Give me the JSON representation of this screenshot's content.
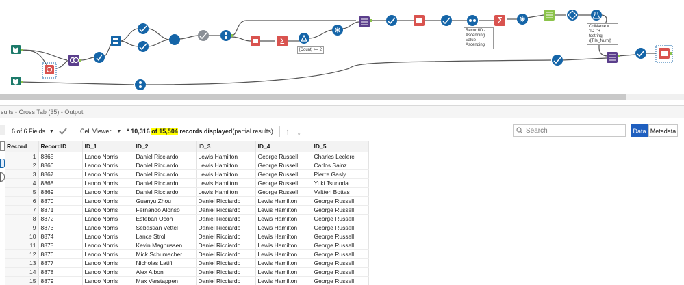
{
  "workflow": {
    "tool_labels": [
      "[Count] >= 2",
      "RecordID -\nAscending\nValue - Ascending",
      "ColName = \"ID_\"+\ntostring\n([Tile_Num])"
    ]
  },
  "results": {
    "title": "sults - Cross Tab (35) - Output"
  },
  "toolbar": {
    "fields_label": "6 of 6 Fields",
    "cell_viewer_label": "Cell Viewer",
    "records_prefix": "* 10,316 ",
    "records_of": "of ",
    "records_total": "15,504",
    "records_suffix": " records displayed",
    "records_note": "(partial results)",
    "search_placeholder": "Search",
    "data_tab": "Data",
    "metadata_tab": "Metadata"
  },
  "grid": {
    "columns": [
      "Record",
      "RecordID",
      "ID_1",
      "ID_2",
      "ID_3",
      "ID_4",
      "ID_5"
    ],
    "rows": [
      [
        "1",
        "8865",
        "Lando Norris",
        "Daniel Ricciardo",
        "Lewis Hamilton",
        "George Russell",
        "Charles Leclerc"
      ],
      [
        "2",
        "8866",
        "Lando Norris",
        "Daniel Ricciardo",
        "Lewis Hamilton",
        "George Russell",
        "Carlos Sainz"
      ],
      [
        "3",
        "8867",
        "Lando Norris",
        "Daniel Ricciardo",
        "Lewis Hamilton",
        "George Russell",
        "Pierre Gasly"
      ],
      [
        "4",
        "8868",
        "Lando Norris",
        "Daniel Ricciardo",
        "Lewis Hamilton",
        "George Russell",
        "Yuki Tsunoda"
      ],
      [
        "5",
        "8869",
        "Lando Norris",
        "Daniel Ricciardo",
        "Lewis Hamilton",
        "George Russell",
        "Valtteri Bottas"
      ],
      [
        "6",
        "8870",
        "Lando Norris",
        "Guanyu Zhou",
        "Daniel Ricciardo",
        "Lewis Hamilton",
        "George Russell"
      ],
      [
        "7",
        "8871",
        "Lando Norris",
        "Fernando Alonso",
        "Daniel Ricciardo",
        "Lewis Hamilton",
        "George Russell"
      ],
      [
        "8",
        "8872",
        "Lando Norris",
        "Esteban Ocon",
        "Daniel Ricciardo",
        "Lewis Hamilton",
        "George Russell"
      ],
      [
        "9",
        "8873",
        "Lando Norris",
        "Sebastian Vettel",
        "Daniel Ricciardo",
        "Lewis Hamilton",
        "George Russell"
      ],
      [
        "10",
        "8874",
        "Lando Norris",
        "Lance Stroll",
        "Daniel Ricciardo",
        "Lewis Hamilton",
        "George Russell"
      ],
      [
        "11",
        "8875",
        "Lando Norris",
        "Kevin Magnussen",
        "Daniel Ricciardo",
        "Lewis Hamilton",
        "George Russell"
      ],
      [
        "12",
        "8876",
        "Lando Norris",
        "Mick Schumacher",
        "Daniel Ricciardo",
        "Lewis Hamilton",
        "George Russell"
      ],
      [
        "13",
        "8877",
        "Lando Norris",
        "Nicholas Latifi",
        "Daniel Ricciardo",
        "Lewis Hamilton",
        "George Russell"
      ],
      [
        "14",
        "8878",
        "Lando Norris",
        "Alex Albon",
        "Daniel Ricciardo",
        "Lewis Hamilton",
        "George Russell"
      ],
      [
        "15",
        "8879",
        "Lando Norris",
        "Max Verstappen",
        "Daniel Ricciardo",
        "Lewis Hamilton",
        "George Russell"
      ]
    ]
  },
  "colors": {
    "accent_blue": "#1f5fbf",
    "highlight": "#ffff00",
    "tool_blue": "#1565a8",
    "tool_teal": "#1d7a6a",
    "tool_red": "#d9534f",
    "tool_purple": "#5b3f8c",
    "tool_green": "#8bc34a"
  }
}
